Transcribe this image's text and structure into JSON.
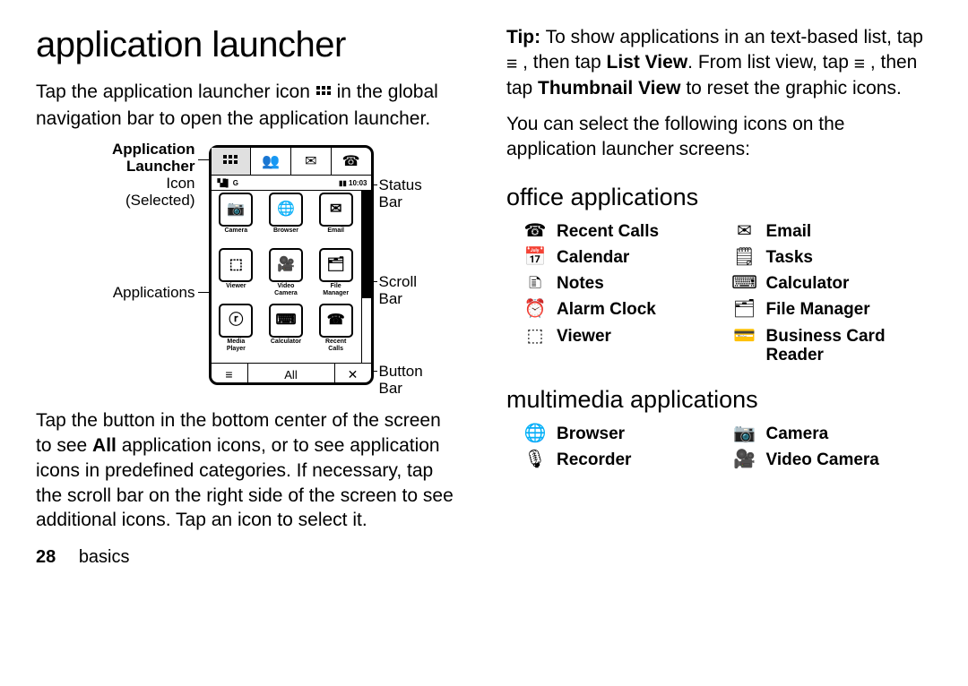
{
  "left": {
    "title": "application launcher",
    "p1a": "Tap the application launcher icon ",
    "p1b": " in the global navigation bar to open the application launcher.",
    "callouts": {
      "launcher_b1": "Application",
      "launcher_b2": "Launcher",
      "launcher_l1": "Icon",
      "launcher_l2": "(Selected)",
      "apps": "Applications",
      "status": "Status Bar",
      "scroll": "Scroll Bar",
      "buttonbar": "Button Bar"
    },
    "phone": {
      "status_left": "▝▟▌ G",
      "status_time": "10:03",
      "apps": [
        {
          "icon": "📷",
          "label": "Camera"
        },
        {
          "icon": "🌐",
          "label": "Browser"
        },
        {
          "icon": "✉",
          "label": "Email"
        },
        {
          "icon": "⬚",
          "label": "Viewer"
        },
        {
          "icon": "🎥",
          "label": "Video\nCamera"
        },
        {
          "icon": "🗂",
          "label": "File\nManager"
        },
        {
          "icon": "ⓡ",
          "label": "Media\nPlayer"
        },
        {
          "icon": "⌨",
          "label": "Calculator"
        },
        {
          "icon": "☎",
          "label": "Recent\nCalls"
        }
      ],
      "btn_mid": "All"
    },
    "p2a": "Tap the button in the bottom center of the screen to see ",
    "p2_all": "All",
    "p2b": " application icons, or to see application icons in predefined categories. If necessary, tap the scroll bar on the right side of the screen to see additional icons. Tap an icon to select it.",
    "footer_page": "28",
    "footer_label": "basics"
  },
  "right": {
    "tip_label": "Tip:",
    "tip_a": " To show applications in an text-based list, tap ",
    "tip_b": " , then tap ",
    "tip_listview": "List View",
    "tip_c": ". From list view, tap ",
    "tip_d": " , then tap ",
    "tip_thumbview": "Thumbnail View",
    "tip_e": " to reset the graphic icons.",
    "p2": "You can select the following icons on the application launcher screens:",
    "office_h": "office applications",
    "office": [
      {
        "icon": "☎",
        "label": "Recent Calls"
      },
      {
        "icon": "✉",
        "label": "Email"
      },
      {
        "icon": "📅",
        "label": "Calendar"
      },
      {
        "icon": "🗒",
        "label": "Tasks"
      },
      {
        "icon": "🗈",
        "label": "Notes"
      },
      {
        "icon": "⌨",
        "label": "Calculator"
      },
      {
        "icon": "⏰",
        "label": "Alarm Clock"
      },
      {
        "icon": "🗂",
        "label": "File Manager"
      },
      {
        "icon": "⬚",
        "label": "Viewer"
      },
      {
        "icon": "💳",
        "label": "Business Card Reader"
      }
    ],
    "mm_h": "multimedia applications",
    "mm": [
      {
        "icon": "🌐",
        "label": "Browser"
      },
      {
        "icon": "📷",
        "label": "Camera"
      },
      {
        "icon": "🎙",
        "label": "Recorder"
      },
      {
        "icon": "🎥",
        "label": "Video Camera"
      }
    ]
  }
}
